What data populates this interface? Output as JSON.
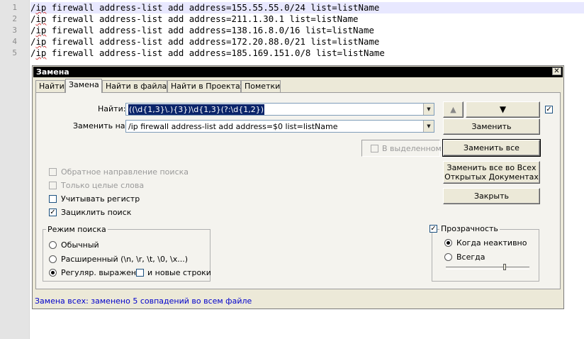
{
  "editor": {
    "lines": [
      {
        "no": "1",
        "prefix": "/",
        "marked": "ip",
        "rest": " firewall address-list add address=155.55.55.0/24 list=listName"
      },
      {
        "no": "2",
        "prefix": "/",
        "marked": "ip",
        "rest": " firewall address-list add address=211.1.30.1 list=listName"
      },
      {
        "no": "3",
        "prefix": "/",
        "marked": "ip",
        "rest": " firewall address-list add address=138.16.8.0/16 list=listName"
      },
      {
        "no": "4",
        "prefix": "/",
        "marked": "ip",
        "rest": " firewall address-list add address=172.20.88.0/21 list=listName"
      },
      {
        "no": "5",
        "prefix": "/",
        "marked": "ip",
        "rest": " firewall address-list add address=185.169.151.0/8 list=listName"
      }
    ]
  },
  "dialog": {
    "title": "Замена",
    "close_glyph": "✕",
    "tabs": [
      "Найти",
      "Замена",
      "Найти в файлах",
      "Найти в Проектах",
      "Пометки"
    ],
    "find_label": "Найти:",
    "find_value": "((\\d{1,3}\\.){3})\\d{1,3}(?:\\d{1,2})",
    "replace_label": "Заменить на:",
    "replace_value": "/ip firewall address-list add address=$0 list=listName",
    "dropdown_glyph": "▼",
    "buttons": {
      "up": "▲",
      "down": "▼",
      "replace": "Заменить",
      "replace_all": "Заменить все",
      "replace_all_docs_line1": "Заменить все во Всех",
      "replace_all_docs_line2": "Открытых Документах",
      "close": "Закрыть"
    },
    "in_selection": "В выделенном",
    "options": {
      "backward": "Обратное направление поиска",
      "whole_words": "Только целые слова",
      "match_case": "Учитывать регистр",
      "wrap": "Зациклить поиск"
    },
    "search_mode": {
      "title": "Режим поиска",
      "normal": "Обычный",
      "extended": "Расширенный (\\n, \\r, \\t, \\0, \\x...)",
      "regex": "Регуляр. выражен.",
      "newline": "и новые строки"
    },
    "transparency": {
      "title": "Прозрачность",
      "inactive": "Когда неактивно",
      "always": "Всегда",
      "level": 0.7
    },
    "check_glyph": "✓",
    "status": "Замена всех: заменено 5 совпадений во всем файле"
  }
}
